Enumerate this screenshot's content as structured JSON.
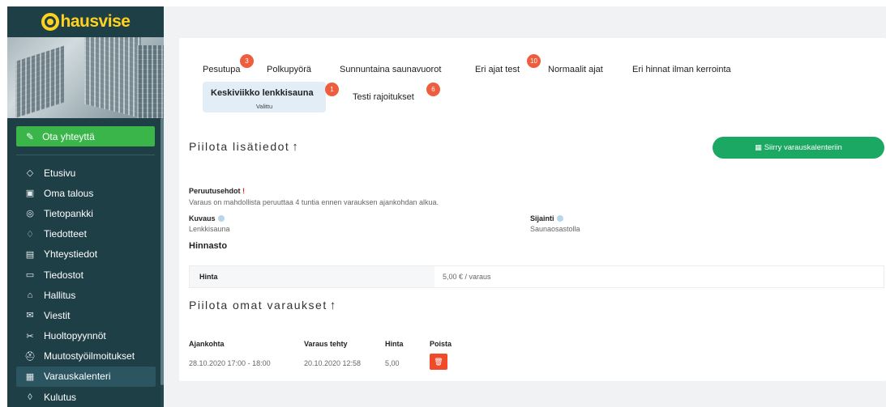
{
  "brand": {
    "name": "hausvise",
    "accent": "#ffd21f"
  },
  "sidebar": {
    "contact_label": "Ota yhteyttä",
    "contact_icon": "pencil-icon",
    "items": [
      {
        "label": "Etusivu",
        "icon": "tag-icon"
      },
      {
        "label": "Oma talous",
        "icon": "money-icon"
      },
      {
        "label": "Tietopankki",
        "icon": "brain-icon"
      },
      {
        "label": "Tiedotteet",
        "icon": "bell-icon"
      },
      {
        "label": "Yhteystiedot",
        "icon": "contact-card-icon"
      },
      {
        "label": "Tiedostot",
        "icon": "folder-icon"
      },
      {
        "label": "Hallitus",
        "icon": "institution-icon"
      },
      {
        "label": "Viestit",
        "icon": "envelope-icon"
      },
      {
        "label": "Huoltopyynnöt",
        "icon": "tools-icon"
      },
      {
        "label": "Muutostyöilmoitukset",
        "icon": "hardhat-icon"
      },
      {
        "label": "Varauskalenteri",
        "icon": "calendar-icon",
        "active": true
      },
      {
        "label": "Kulutus",
        "icon": "drop-icon"
      }
    ]
  },
  "tabs": {
    "row1": [
      {
        "label": "Pesutupa",
        "badge": "3"
      },
      {
        "label": "Polkupyörä"
      },
      {
        "label": "Sunnuntaina saunavuorot"
      },
      {
        "label": "Eri ajat test",
        "badge": "10"
      },
      {
        "label": "Normaalit ajat"
      },
      {
        "label": "Eri hinnat ilman kerrointa"
      }
    ],
    "active": {
      "label": "Keskiviikko lenkkisauna",
      "badge": "1",
      "sub": "Valittu"
    },
    "other": {
      "label": "Testi rajoitukset",
      "badge": "6"
    }
  },
  "details": {
    "toggle_label": "Piilota lisätiedot",
    "calendar_button": "Siirry varauskalenteriin",
    "cancellation_label": "Peruutusehdot",
    "cancellation_text": "Varaus on mahdollista peruuttaa 4 tuntia ennen varauksen ajankohdan alkua.",
    "description_label": "Kuvaus",
    "description_value": "Lenkkisauna",
    "location_label": "Sijainti",
    "location_value": "Saunaosastolla",
    "pricing_heading": "Hinnasto",
    "price_label": "Hinta",
    "price_value": "5,00 € / varaus"
  },
  "reservations": {
    "toggle_label": "Piilota omat varaukset",
    "headers": [
      "Ajankohta",
      "Varaus tehty",
      "Hinta",
      "Poista"
    ],
    "rows": [
      {
        "time": "28.10.2020 17:00 - 18:00",
        "made": "20.10.2020 12:58",
        "price": "5,00"
      }
    ]
  }
}
